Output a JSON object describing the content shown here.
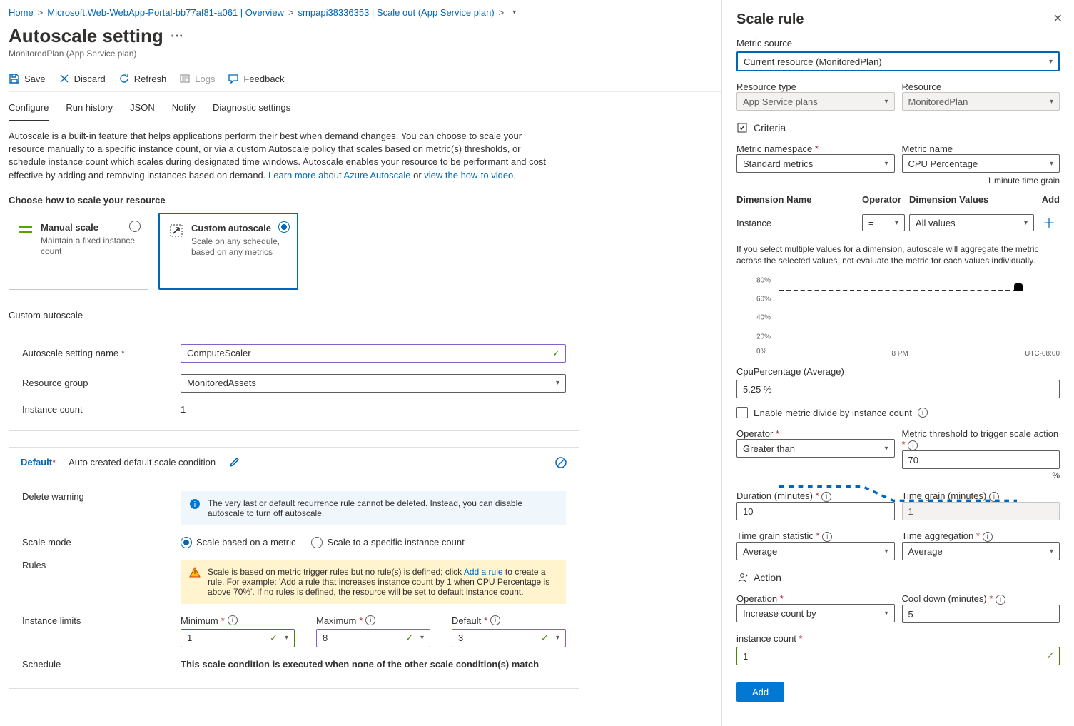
{
  "breadcrumb": [
    {
      "label": "Home"
    },
    {
      "label": "Microsoft.Web-WebApp-Portal-bb77af81-a061 | Overview"
    },
    {
      "label": "smpapi38336353 | Scale out (App Service plan)"
    }
  ],
  "page": {
    "title": "Autoscale setting",
    "subtitle": "MonitoredPlan (App Service plan)"
  },
  "toolbar": {
    "save": "Save",
    "discard": "Discard",
    "refresh": "Refresh",
    "logs": "Logs",
    "feedback": "Feedback"
  },
  "tabs": {
    "configure": "Configure",
    "run_history": "Run history",
    "json": "JSON",
    "notify": "Notify",
    "diagnostic": "Diagnostic settings"
  },
  "description": {
    "text": "Autoscale is a built-in feature that helps applications perform their best when demand changes. You can choose to scale your resource manually to a specific instance count, or via a custom Autoscale policy that scales based on metric(s) thresholds, or schedule instance count which scales during designated time windows. Autoscale enables your resource to be performant and cost effective by adding and removing instances based on demand. ",
    "link1": "Learn more about Azure Autoscale",
    "or": " or ",
    "link2": "view the how-to video",
    "dot": "."
  },
  "scale_choice": {
    "heading": "Choose how to scale your resource",
    "manual": {
      "title": "Manual scale",
      "desc": "Maintain a fixed instance count"
    },
    "custom": {
      "title": "Custom autoscale",
      "desc": "Scale on any schedule, based on any metrics"
    }
  },
  "custom": {
    "heading": "Custom autoscale",
    "name_label": "Autoscale setting name",
    "name_value": "ComputeScaler",
    "rg_label": "Resource group",
    "rg_value": "MonitoredAssets",
    "instance_count_label": "Instance count",
    "instance_count_value": "1"
  },
  "condition": {
    "name": "Default",
    "auto_text": "Auto created default scale condition",
    "delete_label": "Delete warning",
    "delete_info": "The very last or default recurrence rule cannot be deleted. Instead, you can disable autoscale to turn off autoscale.",
    "scale_mode_label": "Scale mode",
    "mode_metric": "Scale based on a metric",
    "mode_count": "Scale to a specific instance count",
    "rules_label": "Rules",
    "rules_warn_pre": "Scale is based on metric trigger rules but no rule(s) is defined; click ",
    "rules_warn_link": "Add a rule",
    "rules_warn_post": " to create a rule. For example: 'Add a rule that increases instance count by 1 when CPU Percentage is above 70%'. If no rules is defined, the resource will be set to default instance count.",
    "limits_label": "Instance limits",
    "min_label": "Minimum",
    "min_value": "1",
    "max_label": "Maximum",
    "max_value": "8",
    "def_label": "Default",
    "def_value": "3",
    "schedule_label": "Schedule",
    "schedule_note": "This scale condition is executed when none of the other scale condition(s) match"
  },
  "panel": {
    "title": "Scale rule",
    "metric_source_label": "Metric source",
    "metric_source_value": "Current resource (MonitoredPlan)",
    "resource_type_label": "Resource type",
    "resource_type_value": "App Service plans",
    "resource_label": "Resource",
    "resource_value": "MonitoredPlan",
    "criteria": "Criteria",
    "metric_ns_label": "Metric namespace",
    "metric_ns_value": "Standard metrics",
    "metric_name_label": "Metric name",
    "metric_name_value": "CPU Percentage",
    "time_grain_hint": "1 minute time grain",
    "dim_name_h": "Dimension Name",
    "operator_h": "Operator",
    "dim_values_h": "Dimension Values",
    "add_h": "Add",
    "dim_name": "Instance",
    "dim_op": "=",
    "dim_val": "All values",
    "dim_note": "If you select multiple values for a dimension, autoscale will aggregate the metric across the selected values, not evaluate the metric for each values individually.",
    "metric_display": "CpuPercentage (Average)",
    "metric_value": "5.25 %",
    "enable_divide": "Enable metric divide by instance count",
    "operator_label": "Operator",
    "operator_value": "Greater than",
    "threshold_label": "Metric threshold to trigger scale action",
    "threshold_value": "70",
    "pct": "%",
    "duration_label": "Duration (minutes)",
    "duration_value": "10",
    "timegrain_label": "Time grain (minutes)",
    "timegrain_value": "1",
    "tgs_label": "Time grain statistic",
    "tgs_value": "Average",
    "ta_label": "Time aggregation",
    "ta_value": "Average",
    "action": "Action",
    "operation_label": "Operation",
    "operation_value": "Increase count by",
    "cooldown_label": "Cool down (minutes)",
    "cooldown_value": "5",
    "icount_label": "instance count",
    "icount_value": "1",
    "add_button": "Add"
  },
  "chart_data": {
    "type": "line",
    "title": "CpuPercentage (Average)",
    "ylabel": "",
    "xlabel": "",
    "ylim": [
      0,
      100
    ],
    "yticks": [
      0,
      20,
      40,
      60,
      80
    ],
    "threshold": 70,
    "x_tick_label": "8 PM",
    "tz": "UTC-08:00",
    "series": [
      {
        "name": "CpuPercentage",
        "approx_values": [
          8,
          8,
          8,
          8,
          3,
          3,
          3,
          3,
          3,
          3,
          3,
          3
        ]
      }
    ]
  }
}
